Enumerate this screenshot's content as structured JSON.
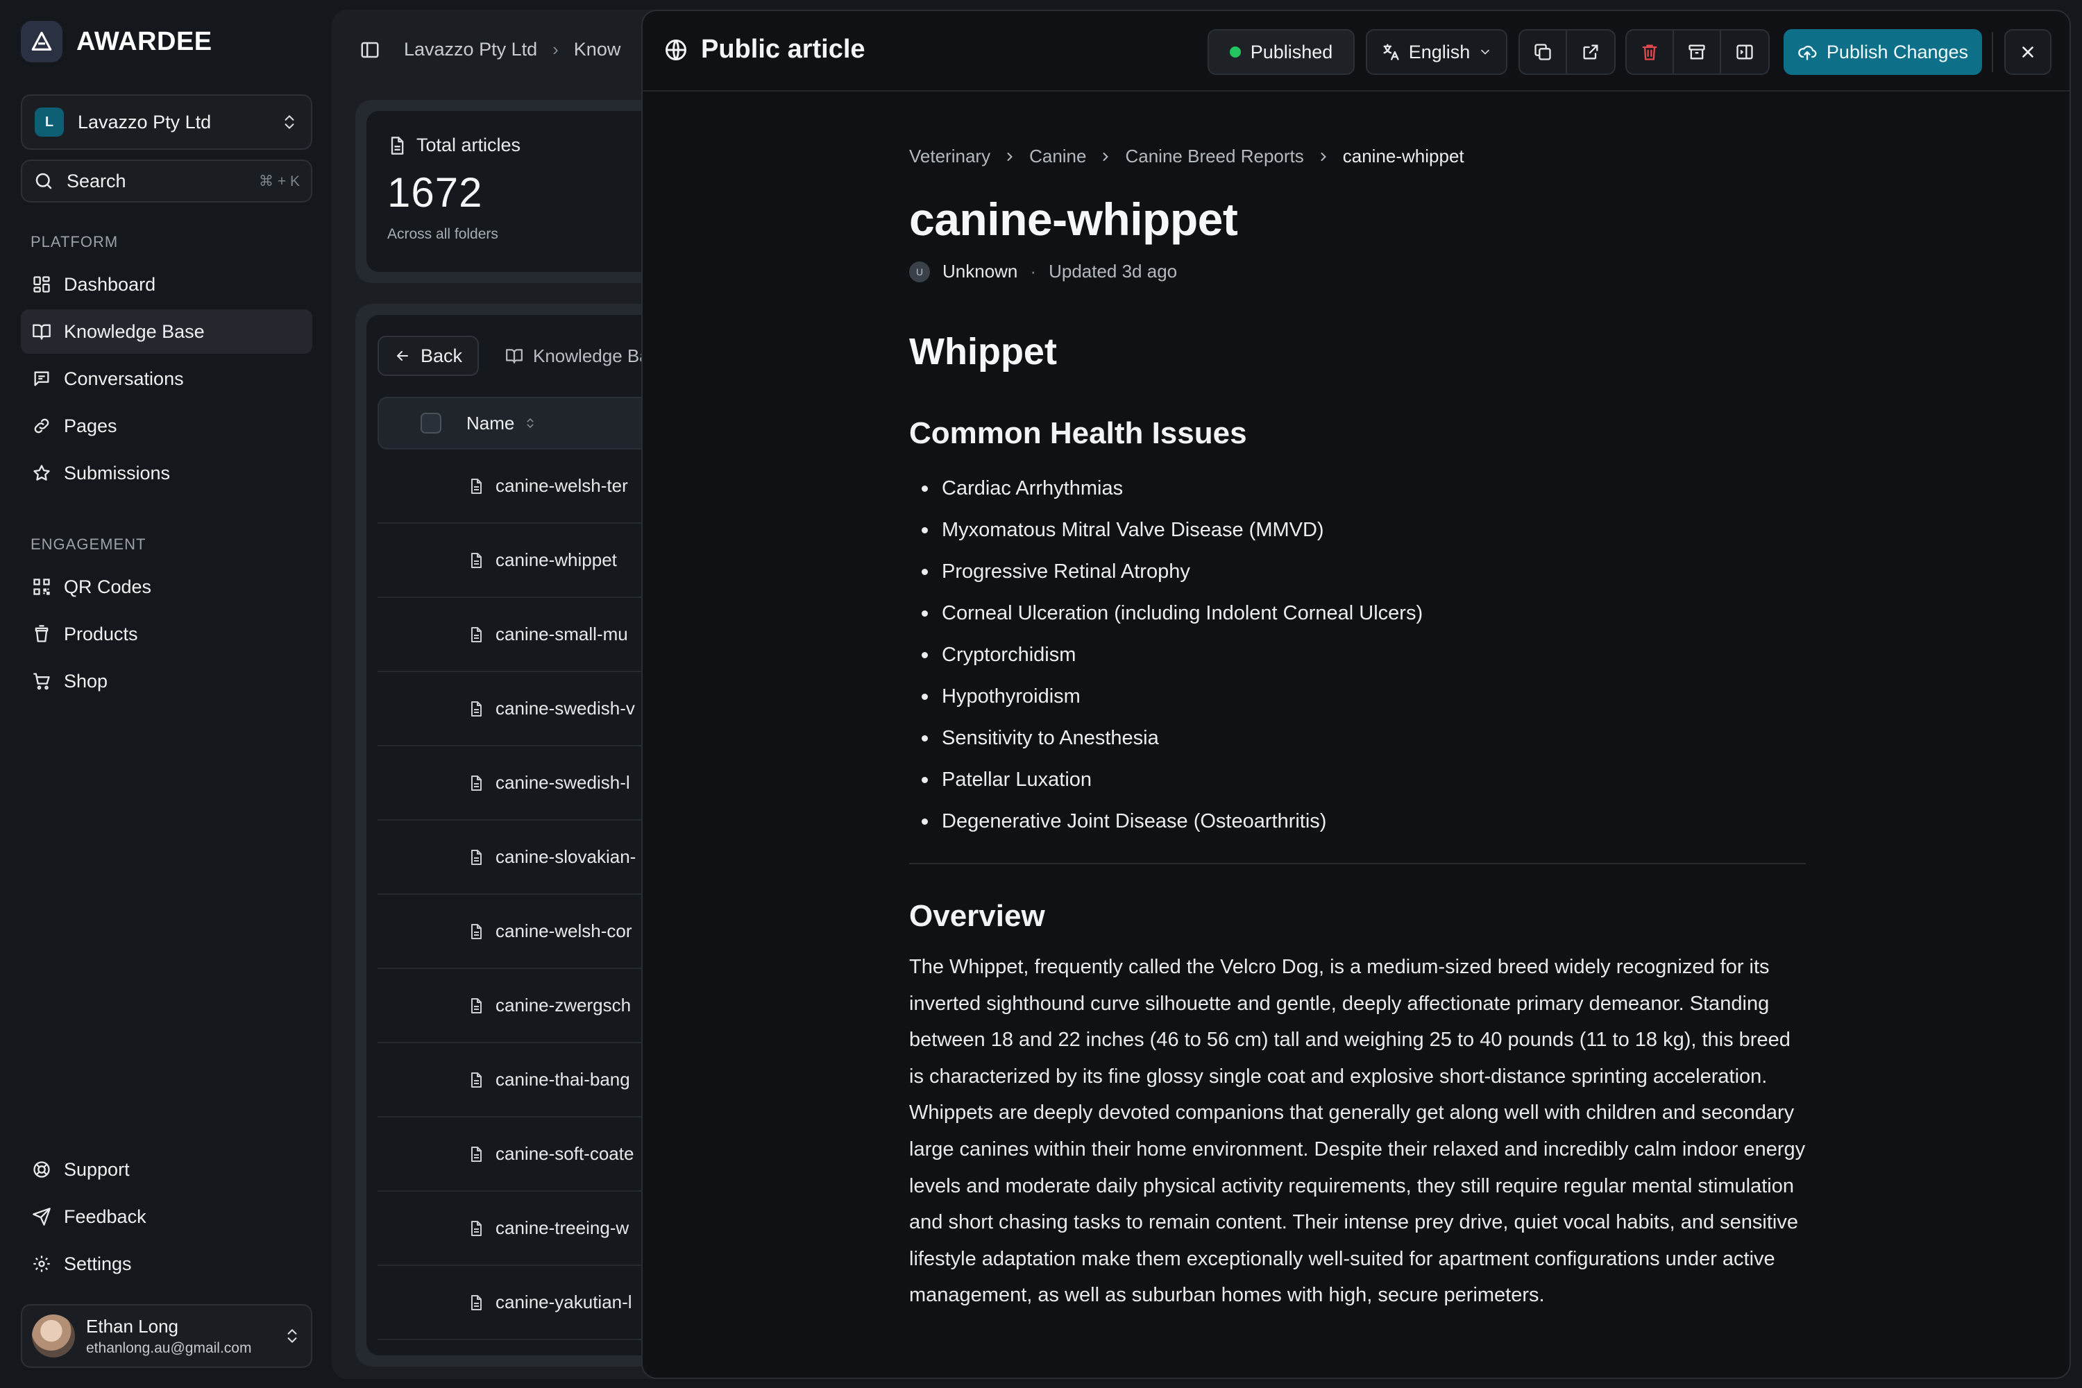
{
  "brand": {
    "name": "AWARDEE"
  },
  "org": {
    "initial": "L",
    "name": "Lavazzo Pty Ltd"
  },
  "search": {
    "label": "Search",
    "shortcut": "⌘ + K"
  },
  "nav": {
    "platform_label": "PLATFORM",
    "platform": [
      {
        "label": "Dashboard",
        "icon": "dashboard-icon"
      },
      {
        "label": "Knowledge Base",
        "icon": "book-icon",
        "active": true
      },
      {
        "label": "Conversations",
        "icon": "chat-icon"
      },
      {
        "label": "Pages",
        "icon": "link-icon"
      },
      {
        "label": "Submissions",
        "icon": "star-icon"
      }
    ],
    "engagement_label": "ENGAGEMENT",
    "engagement": [
      {
        "label": "QR Codes",
        "icon": "qr-code-icon"
      },
      {
        "label": "Products",
        "icon": "cup-icon"
      },
      {
        "label": "Shop",
        "icon": "cart-icon"
      }
    ],
    "footer": [
      {
        "label": "Support",
        "icon": "lifebuoy-icon"
      },
      {
        "label": "Feedback",
        "icon": "send-icon"
      },
      {
        "label": "Settings",
        "icon": "gear-icon"
      }
    ]
  },
  "user": {
    "name": "Ethan Long",
    "email": "ethanlong.au@gmail.com"
  },
  "middle": {
    "breadcrumb": [
      "Lavazzo Pty Ltd",
      "Know"
    ],
    "stat": {
      "label": "Total articles",
      "value": "1672",
      "sub": "Across all folders"
    },
    "back_label": "Back",
    "kb_tab_label": "Knowledge Ba",
    "column_name": "Name",
    "rows": [
      "canine-welsh-ter",
      "canine-whippet",
      "canine-small-mu",
      "canine-swedish-v",
      "canine-swedish-l",
      "canine-slovakian-",
      "canine-welsh-cor",
      "canine-zwergsch",
      "canine-thai-bang",
      "canine-soft-coate",
      "canine-treeing-w",
      "canine-yakutian-l"
    ]
  },
  "drawer": {
    "title": "Public article",
    "status": "Published",
    "status_color": "#22c55e",
    "language": "English",
    "publish_label": "Publish Changes",
    "accent": "#0d6f88",
    "danger": "#e5484d"
  },
  "article": {
    "breadcrumb": [
      "Veterinary",
      "Canine",
      "Canine Breed Reports",
      "canine-whippet"
    ],
    "title": "canine-whippet",
    "author_initial": "U",
    "author": "Unknown",
    "updated": "Updated 3d ago",
    "heading": "Whippet",
    "section1": "Common Health Issues",
    "issues": [
      "Cardiac Arrhythmias",
      "Myxomatous Mitral Valve Disease (MMVD)",
      "Progressive Retinal Atrophy",
      "Corneal Ulceration (including Indolent Corneal Ulcers)",
      "Cryptorchidism",
      "Hypothyroidism",
      "Sensitivity to Anesthesia",
      "Patellar Luxation",
      "Degenerative Joint Disease (Osteoarthritis)"
    ],
    "section2": "Overview",
    "overview": "The Whippet, frequently called the Velcro Dog, is a medium-sized breed widely recognized for its inverted sighthound curve silhouette and gentle, deeply affectionate primary demeanor. Standing between 18 and 22 inches (46 to 56 cm) tall and weighing 25 to 40 pounds (11 to 18 kg), this breed is characterized by its fine glossy single coat and explosive short-distance sprinting acceleration. Whippets are deeply devoted companions that generally get along well with children and secondary large canines within their home environment. Despite their relaxed and incredibly calm indoor energy levels and moderate daily physical activity requirements, they still require regular mental stimulation and short chasing tasks to remain content. Their intense prey drive, quiet vocal habits, and sensitive lifestyle adaptation make them exceptionally well-suited for apartment configurations under active management, as well as suburban homes with high, secure perimeters."
  }
}
